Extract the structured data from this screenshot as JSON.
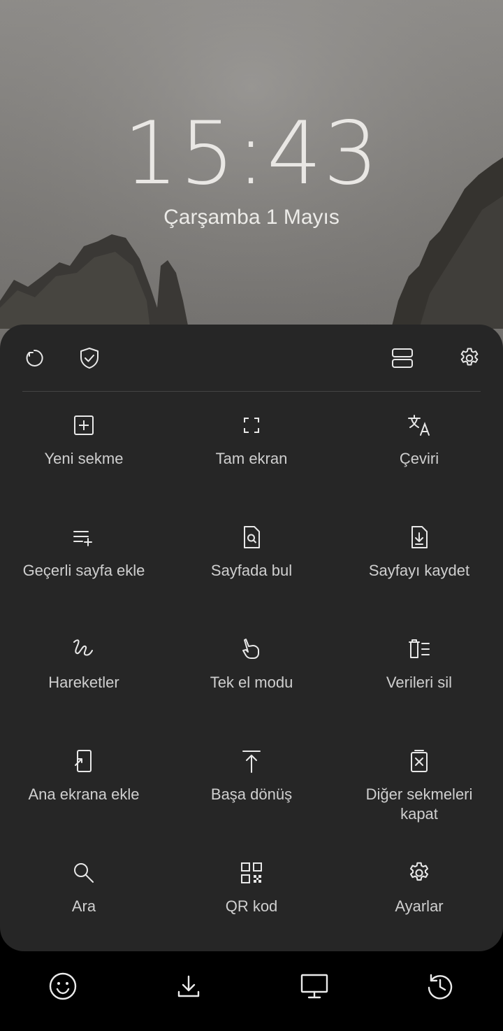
{
  "lockscreen": {
    "time": "15:43",
    "date": "Çarşamba 1 Mayıs"
  },
  "toolbar": {
    "left_icons": [
      "refresh-icon",
      "shield-check-icon"
    ],
    "right_icons": [
      "layout-icon",
      "gear-icon"
    ]
  },
  "menu": {
    "items": [
      {
        "label": "Yeni sekme",
        "icon": "new-tab-icon"
      },
      {
        "label": "Tam ekran",
        "icon": "fullscreen-icon"
      },
      {
        "label": "Çeviri",
        "icon": "translate-icon"
      },
      {
        "label": "Geçerli sayfa ekle",
        "icon": "add-list-icon"
      },
      {
        "label": "Sayfada bul",
        "icon": "find-in-page-icon"
      },
      {
        "label": "Sayfayı kaydet",
        "icon": "save-page-icon"
      },
      {
        "label": "Hareketler",
        "icon": "gesture-icon"
      },
      {
        "label": "Tek el modu",
        "icon": "one-hand-icon"
      },
      {
        "label": "Verileri sil",
        "icon": "delete-data-icon"
      },
      {
        "label": "Ana ekrana ekle",
        "icon": "add-home-icon"
      },
      {
        "label": "Başa dönüş",
        "icon": "back-to-top-icon"
      },
      {
        "label": "Diğer sekmeleri kapat",
        "icon": "close-tabs-icon"
      },
      {
        "label": "Ara",
        "icon": "search-icon"
      },
      {
        "label": "QR kod",
        "icon": "qr-code-icon"
      },
      {
        "label": "Ayarlar",
        "icon": "settings-icon"
      }
    ]
  },
  "bottom_bar": {
    "icons": [
      "emoji-icon",
      "download-icon",
      "desktop-icon",
      "history-icon"
    ]
  }
}
